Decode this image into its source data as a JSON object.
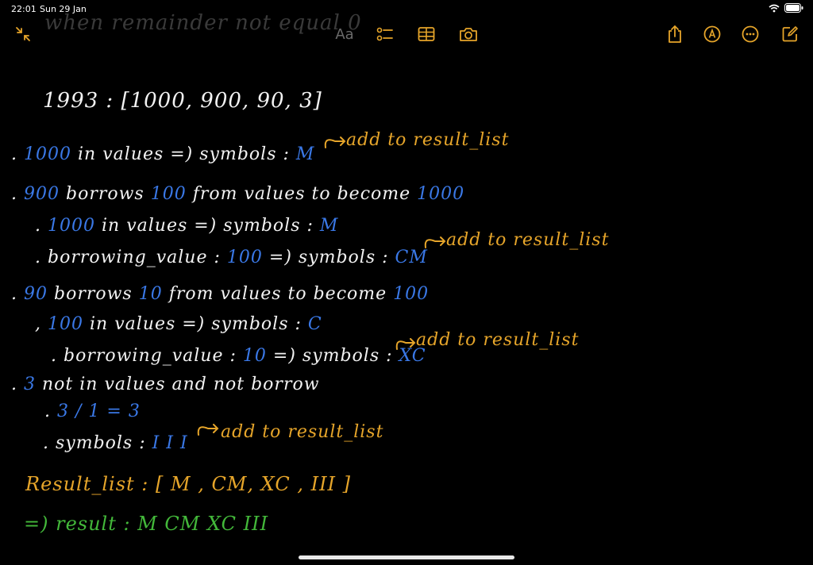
{
  "status": {
    "time": "22:01",
    "date": "Sun 29 Jan"
  },
  "toolbar": {
    "accent": "#e6a52a",
    "items": [
      {
        "name": "collapse-icon"
      },
      {
        "name": "format-icon",
        "label": "Aa"
      },
      {
        "name": "checklist-icon"
      },
      {
        "name": "table-icon"
      },
      {
        "name": "camera-icon"
      },
      {
        "name": "share-icon"
      },
      {
        "name": "markup-icon"
      },
      {
        "name": "more-icon"
      },
      {
        "name": "compose-icon"
      }
    ]
  },
  "note": {
    "faded_top": "when remainder not equal 0",
    "lines": {
      "l1": "1993 : [1000, 900, 90, 3]",
      "l2a": ". ",
      "l2b": "1000",
      "l2c": " in values =) symbols : ",
      "l2d": "M",
      "l2e": "add to result_list",
      "l3a": ". ",
      "l3b": "900",
      "l3c": " borrows ",
      "l3d": "100",
      "l3e": " from values to become ",
      "l3f": "1000",
      "l4a": ". ",
      "l4b": "1000",
      "l4c": " in values =) symbols : ",
      "l4d": "M",
      "l5a": ". borrowing_value : ",
      "l5b": "100",
      "l5c": " =) symbols : ",
      "l5d": "CM",
      "l5e": "add to result_list",
      "l6a": ". ",
      "l6b": "90",
      "l6c": " borrows ",
      "l6d": "10",
      "l6e": " from values to become ",
      "l6f": "100",
      "l7a": ", ",
      "l7b": "100",
      "l7c": " in values =) symbols : ",
      "l7d": "C",
      "l8a": ". borrowing_value : ",
      "l8b": "10",
      "l8c": " =) symbols : ",
      "l8d": "XC",
      "l8e": "add to result_list",
      "l9a": ". ",
      "l9b": "3",
      "l9c": " not in values and not borrow",
      "l10a": ". ",
      "l10b": "3 / 1 = 3",
      "l11a": ". symbols : ",
      "l11b": "I I I",
      "l11c": "add to result_list",
      "l12": "Result_list : [ M , CM, XC , III ]",
      "l13": "=) result : M CM XC III"
    }
  }
}
